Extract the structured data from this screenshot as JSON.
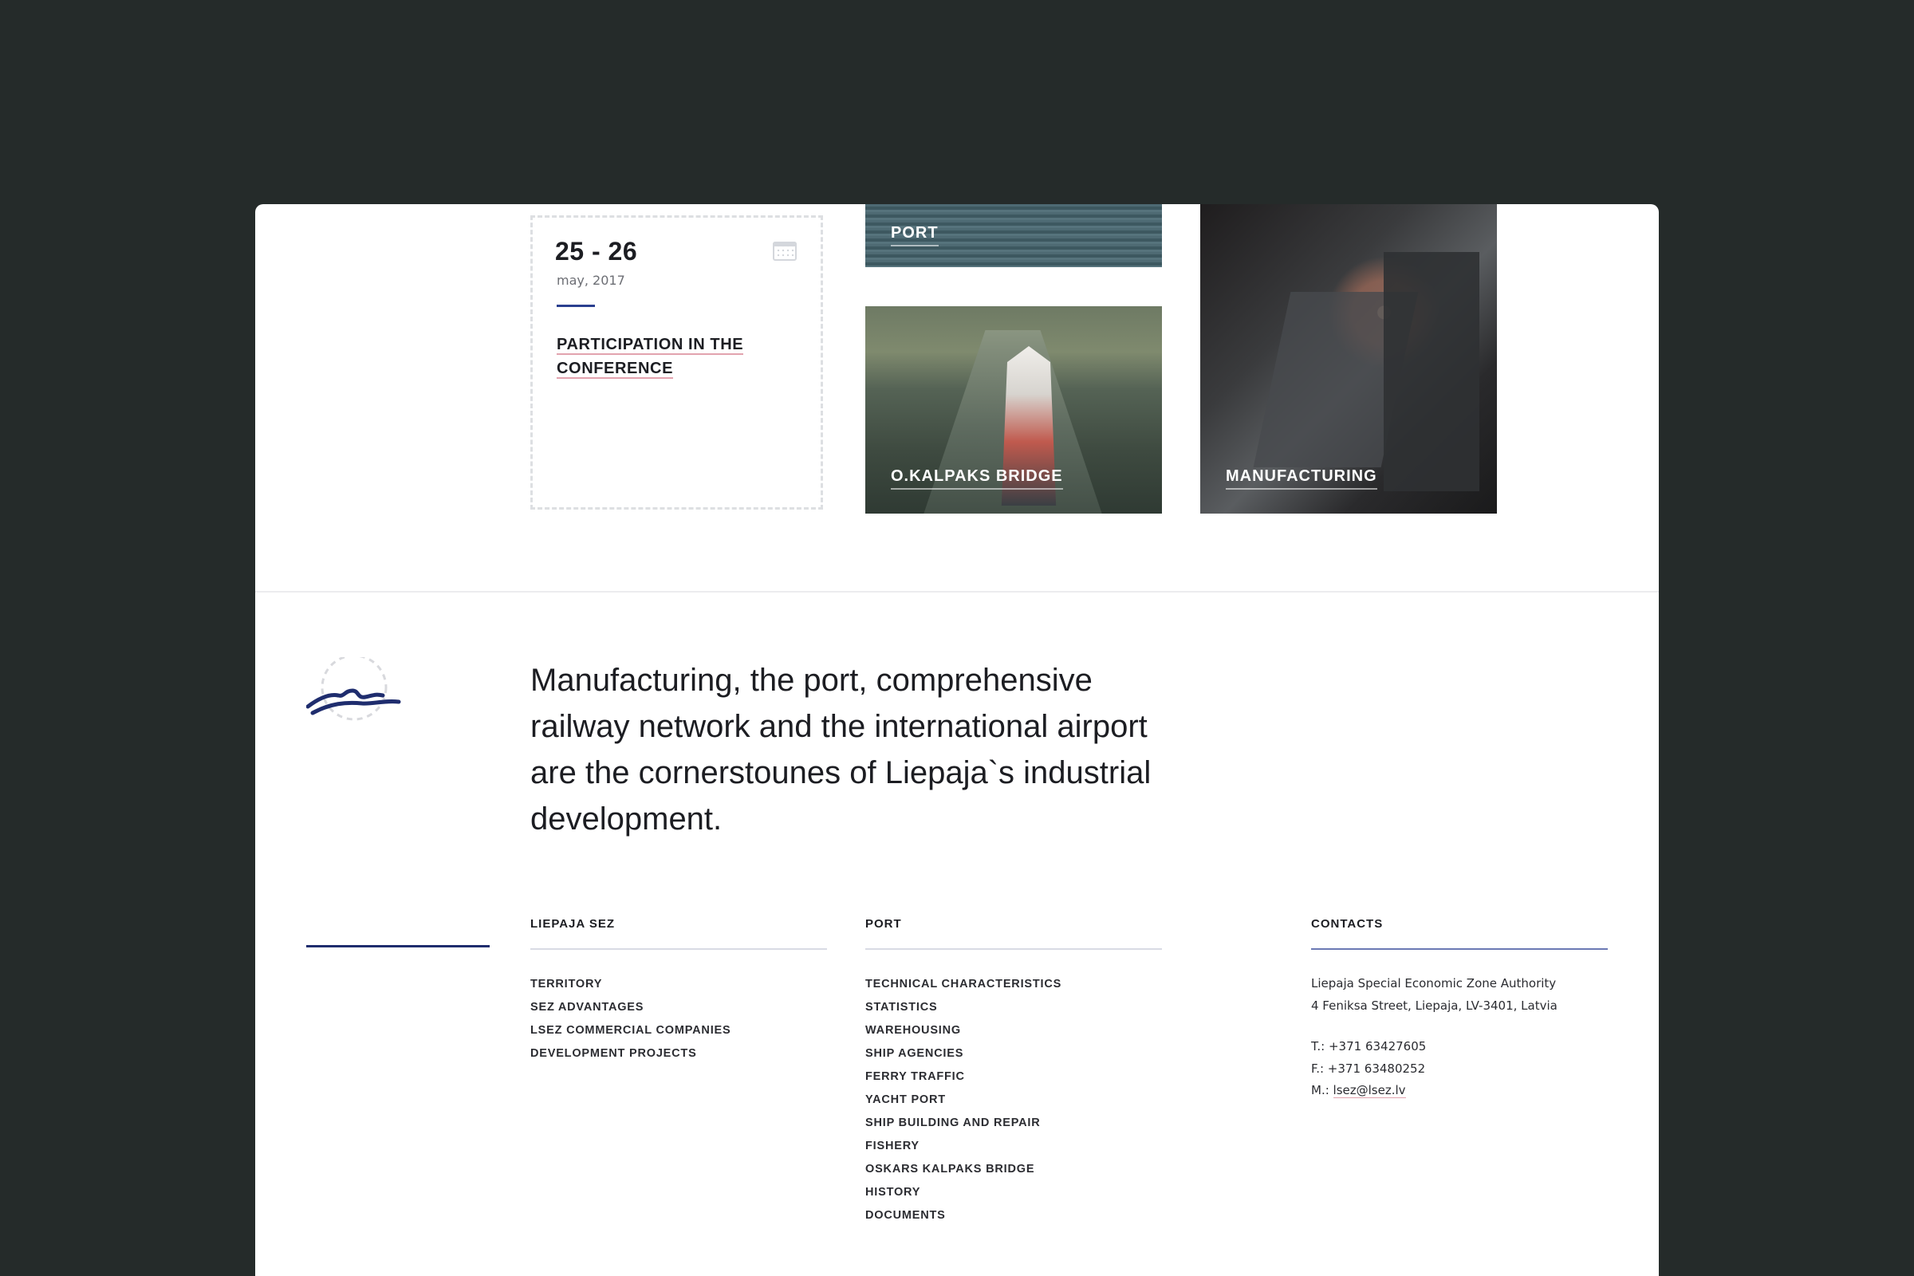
{
  "event": {
    "date": "25 - 26",
    "sub": "may, 2017",
    "title": "PARTICIPATION IN THE CONFERENCE",
    "icon": "calendar-icon"
  },
  "tiles": {
    "port": "PORT",
    "bridge": "O.KALPAKS BRIDGE",
    "manufacturing": "MANUFACTURING"
  },
  "tagline": "Manufacturing, the port, comprehensive railway network and the international airport are the cornerstounes of Liepaja`s industrial development.",
  "footer": {
    "sez": {
      "heading": "LIEPAJA SEZ",
      "items": [
        "TERRITORY",
        "SEZ ADVANTAGES",
        "LSEZ COMMERCIAL COMPANIES",
        "DEVELOPMENT PROJECTS"
      ]
    },
    "port": {
      "heading": "PORT",
      "items": [
        "TECHNICAL CHARACTERISTICS",
        "STATISTICS",
        "WAREHOUSING",
        "SHIP AGENCIES",
        "FERRY TRAFFIC",
        "YACHT PORT",
        "SHIP BUILDING AND REPAIR",
        "FISHERY",
        "OSKARS KALPAKS BRIDGE",
        "HISTORY",
        "DOCUMENTS"
      ]
    },
    "contacts": {
      "heading": "CONTACTS",
      "org": "Liepaja Special Economic Zone Authority",
      "address": "4 Feniksa Street, Liepaja, LV-3401, Latvia",
      "phone": "T.: +371 63427605",
      "fax": "F.: +371 63480252",
      "mail_prefix": "M.: ",
      "mail": "lsez@lsez.lv"
    }
  },
  "colors": {
    "background": "#252b2a",
    "accent": "#1f2d6e",
    "underline": "#e2a3ae"
  }
}
